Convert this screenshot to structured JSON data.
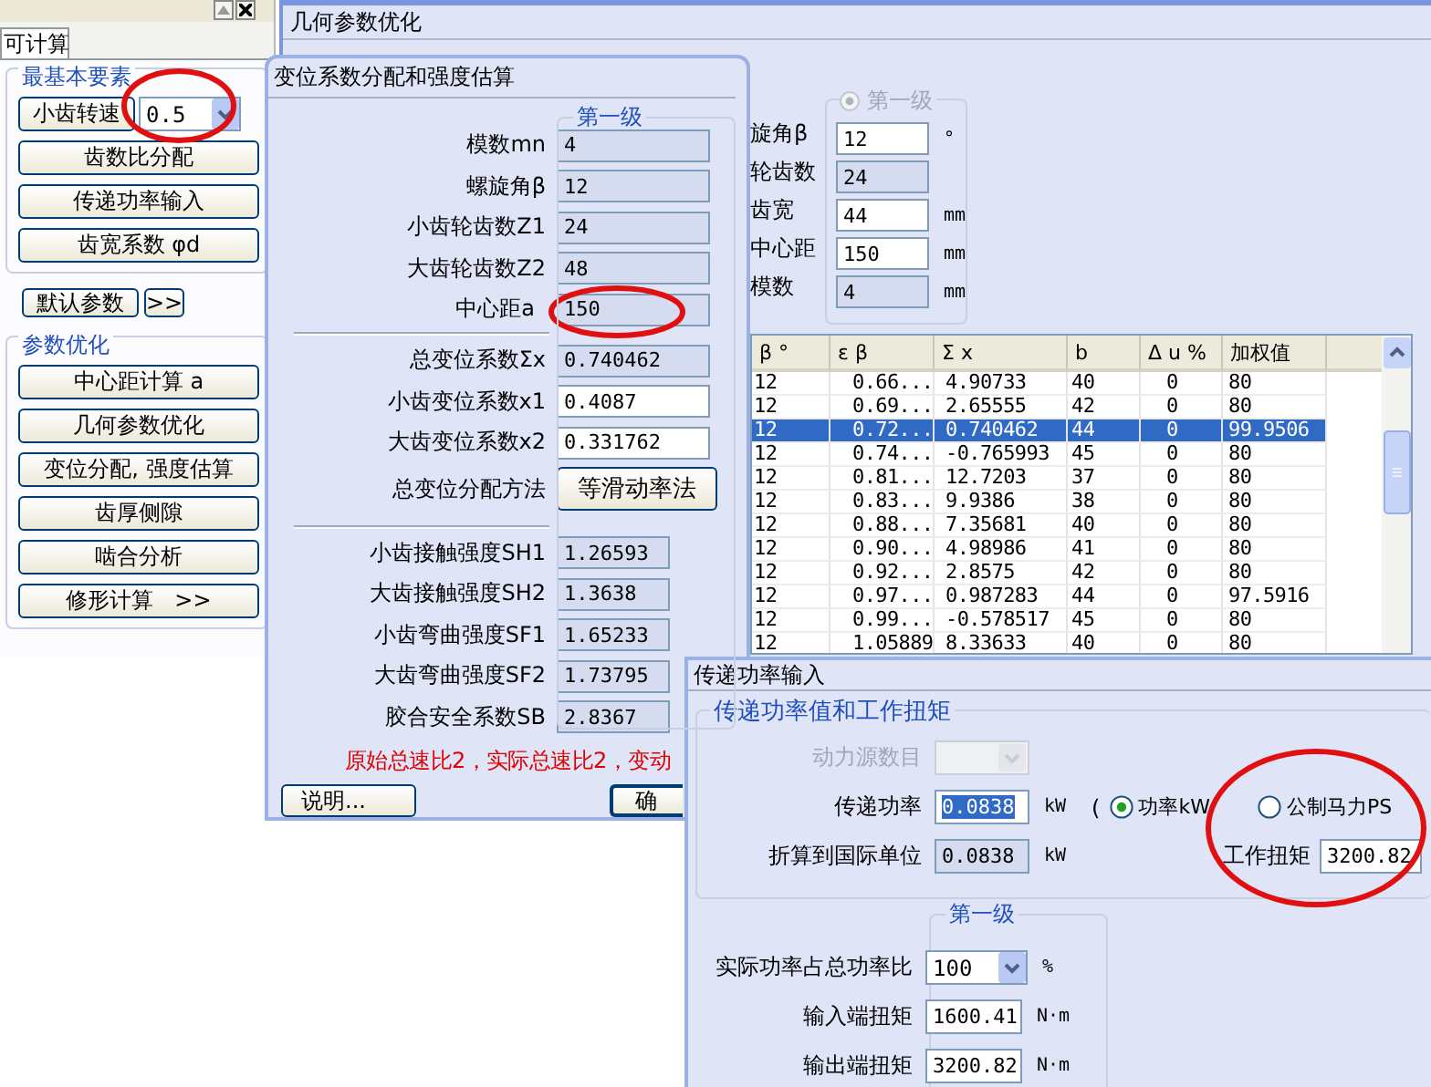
{
  "left_panel": {
    "tab": "可计算",
    "basic": {
      "title": "最基本要素",
      "speed_button": "小齿转速",
      "speed_value": "0.5",
      "buttons": [
        "齿数比分配",
        "传递功率输入",
        "齿宽系数 φd"
      ]
    },
    "defaults": {
      "button": "默认参数",
      "more": ">>"
    },
    "optimize": {
      "title": "参数优化",
      "buttons": [
        "中心距计算 a",
        "几何参数优化",
        "变位分配, 强度估算",
        "齿厚侧隙",
        "啮合分析",
        "修形计算   >>"
      ]
    }
  },
  "main_window": {
    "title": "几何参数优化",
    "group": {
      "title": "第一级",
      "selected": true,
      "fields": [
        {
          "label": "旋角β",
          "value": "12",
          "unit": "°",
          "editable": true
        },
        {
          "label": "轮齿数",
          "value": "24",
          "editable": false
        },
        {
          "label": "齿宽",
          "value": "44",
          "unit": "mm",
          "editable": true
        },
        {
          "label": "中心距",
          "value": "150",
          "unit": "mm",
          "editable": true
        },
        {
          "label": "模数",
          "value": "4",
          "unit": "mm",
          "editable": false
        }
      ]
    },
    "table": {
      "columns": [
        "β °",
        "ε β",
        "Σ x",
        "b",
        "Δ u %",
        "加权值"
      ],
      "rows": [
        {
          "cells": [
            "12",
            "0.66...",
            "4.90733",
            "40",
            "0",
            "80"
          ],
          "selected": false
        },
        {
          "cells": [
            "12",
            "0.69...",
            "2.65555",
            "42",
            "0",
            "80"
          ],
          "selected": false
        },
        {
          "cells": [
            "12",
            "0.72...",
            "0.740462",
            "44",
            "0",
            "99.9506"
          ],
          "selected": true
        },
        {
          "cells": [
            "12",
            "0.74...",
            "-0.765993",
            "45",
            "0",
            "80"
          ],
          "selected": false
        },
        {
          "cells": [
            "12",
            "0.81...",
            "12.7203",
            "37",
            "0",
            "80"
          ],
          "selected": false
        },
        {
          "cells": [
            "12",
            "0.83...",
            "9.9386",
            "38",
            "0",
            "80"
          ],
          "selected": false
        },
        {
          "cells": [
            "12",
            "0.88...",
            "7.35681",
            "40",
            "0",
            "80"
          ],
          "selected": false
        },
        {
          "cells": [
            "12",
            "0.90...",
            "4.98986",
            "41",
            "0",
            "80"
          ],
          "selected": false
        },
        {
          "cells": [
            "12",
            "0.92...",
            "2.8575",
            "42",
            "0",
            "80"
          ],
          "selected": false
        },
        {
          "cells": [
            "12",
            "0.97...",
            "0.987283",
            "44",
            "0",
            "97.5916"
          ],
          "selected": false
        },
        {
          "cells": [
            "12",
            "0.99...",
            "-0.578517",
            "45",
            "0",
            "80"
          ],
          "selected": false
        },
        {
          "cells": [
            "12",
            "1.05889",
            "8.33633",
            "40",
            "0",
            "80"
          ],
          "selected": false
        }
      ]
    }
  },
  "allocation_dialog": {
    "title": "变位系数分配和强度估算",
    "level_title": "第一级",
    "inputs": [
      {
        "label": "模数mn",
        "value": "4",
        "editable": false
      },
      {
        "label": "螺旋角β",
        "value": "12",
        "editable": false
      },
      {
        "label": "小齿轮齿数Z1",
        "value": "24",
        "editable": false
      },
      {
        "label": "大齿轮齿数Z2",
        "value": "48",
        "editable": false
      },
      {
        "label": "中心距a",
        "value": "150",
        "editable": false
      }
    ],
    "shift": [
      {
        "label": "总变位系数Σx",
        "value": "0.740462",
        "editable": false
      },
      {
        "label": "小齿变位系数x1",
        "value": "0.4087",
        "editable": true
      },
      {
        "label": "大齿变位系数x2",
        "value": "0.331762",
        "editable": true
      }
    ],
    "method": {
      "label": "总变位分配方法",
      "button": "等滑动率法"
    },
    "strength": [
      {
        "label": "小齿接触强度SH1",
        "value": "1.26593"
      },
      {
        "label": "大齿接触强度SH2",
        "value": "1.3638"
      },
      {
        "label": "小齿弯曲强度SF1",
        "value": "1.65233"
      },
      {
        "label": "大齿弯曲强度SF2",
        "value": "1.73795"
      },
      {
        "label": "胶合安全系数SB",
        "value": "2.8367"
      }
    ],
    "message": "原始总速比2，实际总速比2，变动",
    "buttons": [
      "说明...",
      "确"
    ]
  },
  "power_dialog": {
    "title": "传递功率输入",
    "group_title": "传递功率值和工作扭矩",
    "source": {
      "label": "动力源数目",
      "disabled": true
    },
    "power": {
      "label": "传递功率",
      "value": "0.0838",
      "text_selected": true,
      "unit": "kW",
      "paren": "(",
      "options": [
        {
          "label": "功率kW",
          "selected": true
        },
        {
          "label": "公制马力PS",
          "selected": false
        }
      ]
    },
    "converted": {
      "label": "折算到国际单位",
      "value": "0.0838",
      "unit": "kW"
    },
    "torque": {
      "label": "工作扭矩",
      "value": "3200.82"
    },
    "level": {
      "title": "第一级",
      "ratio": {
        "label": "实际功率占总功率比",
        "value": "100",
        "unit": "%"
      },
      "rows": [
        {
          "label": "输入端扭矩",
          "value": "1600.41",
          "unit": "N·m"
        },
        {
          "label": "输出端扭矩",
          "value": "3200.82",
          "unit": "N·m"
        }
      ]
    }
  }
}
